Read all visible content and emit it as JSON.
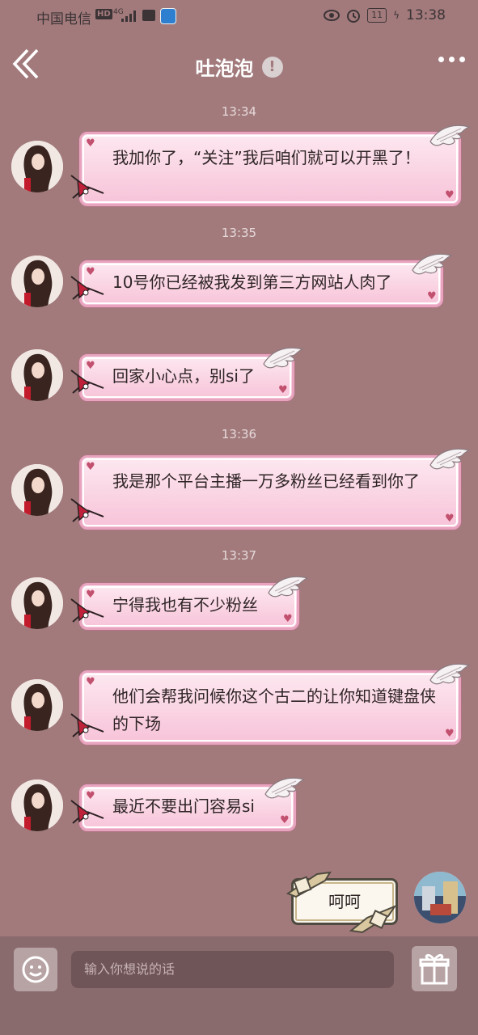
{
  "status_bar": {
    "carrier": "中国电信",
    "hd": "HD",
    "network": "4G",
    "battery": "11",
    "time": "13:38"
  },
  "header": {
    "title": "吐泡泡",
    "warning_glyph": "!"
  },
  "icons": [
    "back-chevron-icon",
    "warning-icon",
    "more-icon",
    "eye-icon",
    "alarm-icon",
    "battery-icon",
    "emoji-icon",
    "gift-icon",
    "wing-icon",
    "ribbon-icon",
    "heart-icon"
  ],
  "colors": {
    "background": "#a27a7c",
    "bubble_pink": "#f7c3d8",
    "input_bar": "#8a6b6d"
  },
  "messages": [
    {
      "time": "13:34",
      "text": "我加你了，“关注”我后咱们就可以开黑了！"
    },
    {
      "time": "13:35",
      "text": "10号你已经被我发到第三方网站人肉了"
    },
    {
      "time": "",
      "text": "回家小心点，别si了"
    },
    {
      "time": "13:36",
      "text": "我是那个平台主播一万多粉丝已经看到你了"
    },
    {
      "time": "13:37",
      "text": "宁得我也有不少粉丝"
    },
    {
      "time": "",
      "text": "他们会帮我问候你这个古二的让你知道键盘侠的下场"
    },
    {
      "time": "",
      "text": "最近不要出门容易si"
    }
  ],
  "my_message": {
    "text": "呵呵"
  },
  "input": {
    "placeholder": "输入你想说的话"
  }
}
